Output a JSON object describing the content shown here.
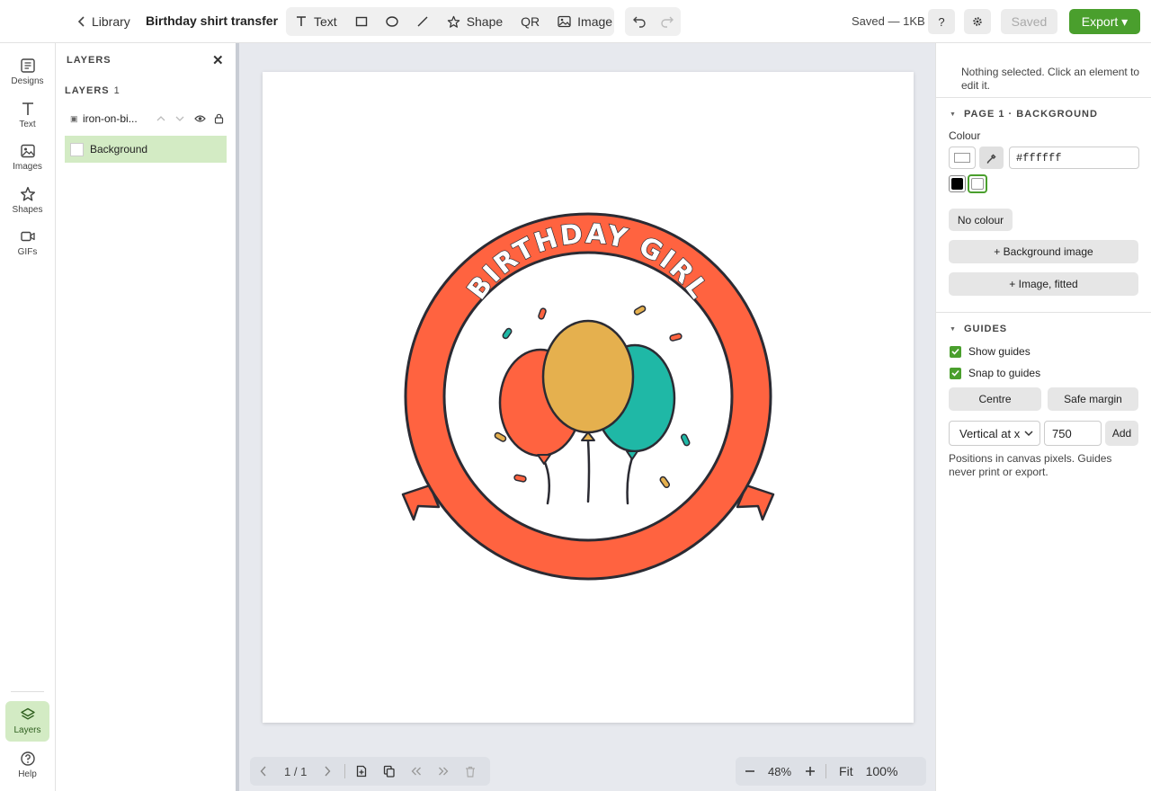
{
  "topbar": {
    "back_label": "Library",
    "title": "Birthday shirt transfer",
    "tools": {
      "text": "Text",
      "shape": "Shape",
      "qr": "QR",
      "image": "Image"
    },
    "save_status": "Saved — 1KB",
    "help": "?",
    "saved_button": "Saved",
    "export_button": "Export ▾"
  },
  "rail": {
    "designs": "Designs",
    "text": "Text",
    "images": "Images",
    "shapes": "Shapes",
    "gifs": "GIFs",
    "layers": "Layers",
    "help": "Help"
  },
  "layers_panel": {
    "title": "LAYERS",
    "section_label": "LAYERS",
    "count": "1",
    "items": [
      {
        "name": "iron-on-bi..."
      },
      {
        "name": "Background"
      }
    ]
  },
  "artwork": {
    "curved_text": "BIRTHDAY GIRL",
    "colors": {
      "ring": "#ff6340",
      "outline": "#2b2b33",
      "balloon_left": "#ff6340",
      "balloon_middle": "#e5b04e",
      "balloon_right": "#1fb8a6"
    }
  },
  "bottombar": {
    "page_indicator": "1 / 1",
    "zoom": "48%",
    "fit": "Fit",
    "full": "100%"
  },
  "properties": {
    "nothing_selected": "Nothing selected. Click an element to edit it.",
    "background_section": "PAGE 1 · BACKGROUND",
    "colour_label": "Colour",
    "colour_value": "#ffffff",
    "swatches": [
      "#000000",
      "#ffffff"
    ],
    "no_colour": "No colour",
    "background_image": "+ Background image",
    "image_fitted": "+ Image, fitted",
    "guides_section": "GUIDES",
    "show_guides": "Show guides",
    "snap_to_guides": "Snap to guides",
    "centre": "Centre",
    "safe_margin": "Safe margin",
    "orientation": "Vertical at x",
    "position_value": "750",
    "add": "Add",
    "guides_hint": "Positions in canvas pixels. Guides never print or export."
  },
  "accent": "#4a9f2d"
}
